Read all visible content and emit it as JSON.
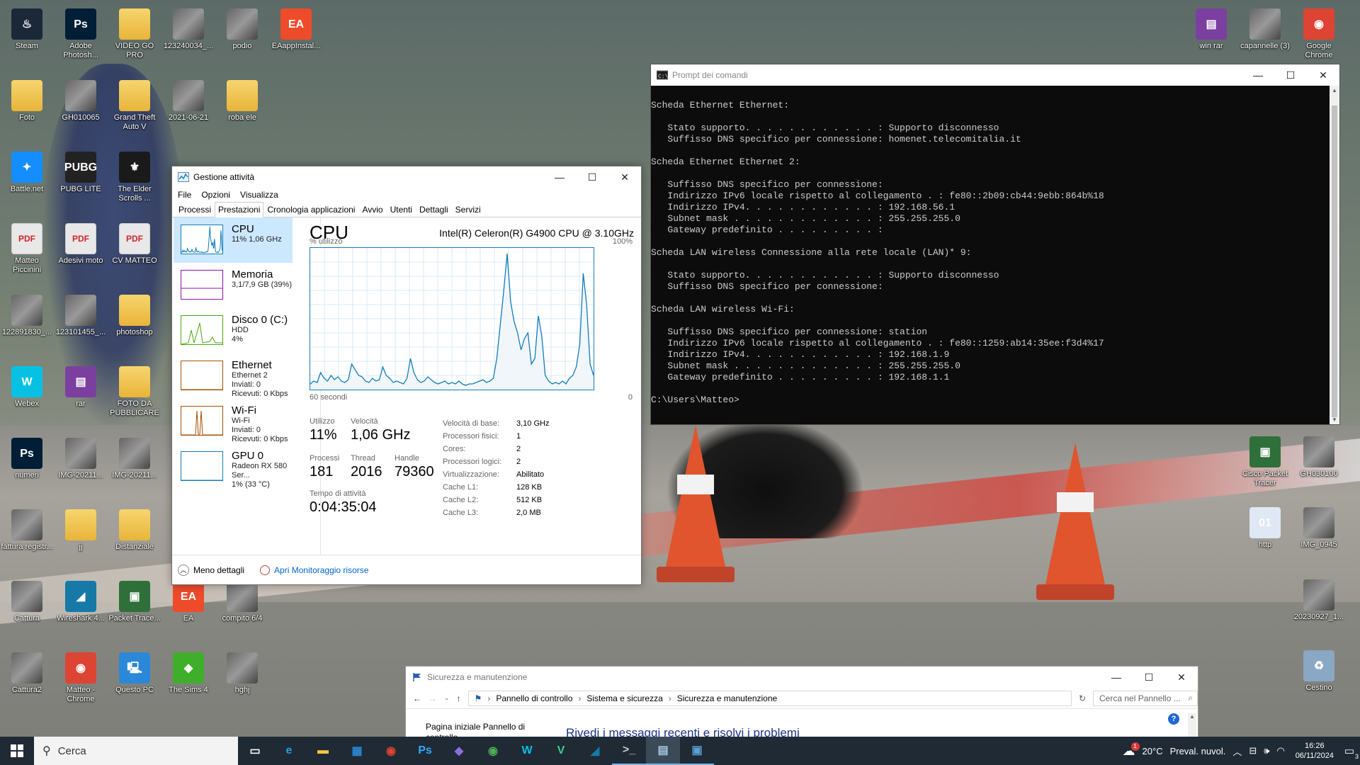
{
  "desktop": {
    "icons": [
      {
        "label": "Steam",
        "glyph": "♨",
        "kind": "app",
        "color": "#1b2838",
        "col": 0,
        "row": 0
      },
      {
        "label": "Adobe Photosh...",
        "glyph": "Ps",
        "kind": "app",
        "color": "#001e36",
        "col": 1,
        "row": 0
      },
      {
        "label": "VIDEO GO PRO",
        "glyph": "",
        "kind": "folder",
        "col": 2,
        "row": 0
      },
      {
        "label": "123240034_...",
        "glyph": "",
        "kind": "photo",
        "col": 3,
        "row": 0
      },
      {
        "label": "podio",
        "glyph": "",
        "kind": "photo",
        "col": 4,
        "row": 0
      },
      {
        "label": "EAappInstal...",
        "glyph": "EA",
        "kind": "app",
        "color": "#ee4b2b",
        "col": 5,
        "row": 0
      },
      {
        "label": "Foto",
        "glyph": "",
        "kind": "folder",
        "col": 0,
        "row": 1
      },
      {
        "label": "GH010065",
        "glyph": "",
        "kind": "photo",
        "col": 1,
        "row": 1
      },
      {
        "label": "Grand Theft Auto V",
        "glyph": "",
        "kind": "folder",
        "col": 2,
        "row": 1
      },
      {
        "label": "2021-06-21",
        "glyph": "",
        "kind": "photo",
        "col": 3,
        "row": 1
      },
      {
        "label": "roba ele",
        "glyph": "",
        "kind": "folder",
        "col": 4,
        "row": 1
      },
      {
        "label": "Battle.net",
        "glyph": "✦",
        "kind": "app",
        "color": "#148eff",
        "col": 0,
        "row": 2
      },
      {
        "label": "PUBG LITE",
        "glyph": "PUBG",
        "kind": "app",
        "color": "#222222",
        "col": 1,
        "row": 2
      },
      {
        "label": "The Elder Scrolls ...",
        "glyph": "⚜",
        "kind": "app",
        "color": "#1a1a1a",
        "col": 2,
        "row": 2
      },
      {
        "label": "Matteo Piccinini",
        "glyph": "PDF",
        "kind": "pdf",
        "col": 0,
        "row": 3
      },
      {
        "label": "Adesivi moto",
        "glyph": "PDF",
        "kind": "pdf",
        "col": 1,
        "row": 3
      },
      {
        "label": "CV MATTEO",
        "glyph": "PDF",
        "kind": "pdf",
        "col": 2,
        "row": 3
      },
      {
        "label": "122891830_...",
        "glyph": "",
        "kind": "photo",
        "col": 0,
        "row": 4
      },
      {
        "label": "123101455_...",
        "glyph": "",
        "kind": "photo",
        "col": 1,
        "row": 4
      },
      {
        "label": "photoshop",
        "glyph": "",
        "kind": "folder",
        "col": 2,
        "row": 4
      },
      {
        "label": "Webex",
        "glyph": "W",
        "kind": "app",
        "color": "#07c1e4",
        "col": 0,
        "row": 5
      },
      {
        "label": "rar",
        "glyph": "▤",
        "kind": "app",
        "color": "#7b3fa0",
        "col": 1,
        "row": 5
      },
      {
        "label": "FOTO DA PUBBLICARE",
        "glyph": "",
        "kind": "folder",
        "col": 2,
        "row": 5
      },
      {
        "label": "numeri",
        "glyph": "Ps",
        "kind": "app",
        "color": "#001e36",
        "col": 0,
        "row": 6
      },
      {
        "label": "IMG-20211...",
        "glyph": "",
        "kind": "photo",
        "col": 1,
        "row": 6
      },
      {
        "label": "IMG-20211...",
        "glyph": "",
        "kind": "photo",
        "col": 2,
        "row": 6
      },
      {
        "label": "fattura registr...",
        "glyph": "",
        "kind": "photo",
        "col": 0,
        "row": 7
      },
      {
        "label": "jj",
        "glyph": "",
        "kind": "folder",
        "col": 1,
        "row": 7
      },
      {
        "label": "Distanziale",
        "glyph": "",
        "kind": "folder",
        "col": 2,
        "row": 7
      },
      {
        "label": "Cattura",
        "glyph": "",
        "kind": "photo",
        "col": 0,
        "row": 8
      },
      {
        "label": "Wireshark 4...",
        "glyph": "◢",
        "kind": "app",
        "color": "#1679a7",
        "col": 1,
        "row": 8
      },
      {
        "label": "Packet Trace...",
        "glyph": "▣",
        "kind": "app",
        "color": "#2f6f3a",
        "col": 2,
        "row": 8
      },
      {
        "label": "EA",
        "glyph": "EA",
        "kind": "app",
        "color": "#ee4b2b",
        "col": 3,
        "row": 8
      },
      {
        "label": "compito 6/4",
        "glyph": "",
        "kind": "photo",
        "col": 4,
        "row": 8
      },
      {
        "label": "Cattura2",
        "glyph": "",
        "kind": "photo",
        "col": 0,
        "row": 9
      },
      {
        "label": "Matteo - Chrome",
        "glyph": "◉",
        "kind": "app",
        "color": "#dd4433",
        "col": 1,
        "row": 9
      },
      {
        "label": "Questo PC",
        "glyph": "🖳",
        "kind": "app",
        "color": "#2b88d8",
        "col": 2,
        "row": 9
      },
      {
        "label": "The Sims 4",
        "glyph": "◆",
        "kind": "app",
        "color": "#3fae2a",
        "col": 3,
        "row": 9
      },
      {
        "label": "hghj",
        "glyph": "",
        "kind": "photo",
        "col": 4,
        "row": 9
      }
    ],
    "right_icons": [
      {
        "label": "win rar",
        "glyph": "▤",
        "kind": "app",
        "color": "#7b3fa0"
      },
      {
        "label": "capannelle (3)",
        "glyph": "",
        "kind": "photo"
      },
      {
        "label": "Google Chrome",
        "glyph": "◉",
        "kind": "app",
        "color": "#dd4433"
      },
      {
        "label": "Cisco Packet Tracer",
        "glyph": "▣",
        "kind": "app",
        "color": "#2f6f3a"
      },
      {
        "label": "GH030100",
        "glyph": "",
        "kind": "photo"
      },
      {
        "label": "http",
        "glyph": "01",
        "kind": "app",
        "color": "#dfe8f5"
      },
      {
        "label": "IMG_0945",
        "glyph": "",
        "kind": "photo"
      },
      {
        "label": "20230927_1...",
        "glyph": "",
        "kind": "photo"
      },
      {
        "label": "Cestino",
        "glyph": "♻",
        "kind": "app",
        "color": "#8aa7c4"
      }
    ]
  },
  "task_manager": {
    "title": "Gestione attività",
    "menu": [
      "File",
      "Opzioni",
      "Visualizza"
    ],
    "tabs": [
      "Processi",
      "Prestazioni",
      "Cronologia applicazioni",
      "Avvio",
      "Utenti",
      "Dettagli",
      "Servizi"
    ],
    "active_tab": "Prestazioni",
    "resources": [
      {
        "name": "CPU",
        "sub1": "11% 1,06 GHz",
        "sub2": "",
        "sub3": "",
        "color": "#117dbb"
      },
      {
        "name": "Memoria",
        "sub1": "3,1/7,9 GB (39%)",
        "sub2": "",
        "sub3": "",
        "color": "#8b12ae"
      },
      {
        "name": "Disco 0 (C:)",
        "sub1": "HDD",
        "sub2": "4%",
        "sub3": "",
        "color": "#4da60c"
      },
      {
        "name": "Ethernet",
        "sub1": "Ethernet 2",
        "sub2": "Inviati: 0 Ricevuti: 0 Kbps",
        "sub3": "",
        "color": "#a74f01"
      },
      {
        "name": "Wi-Fi",
        "sub1": "Wi-Fi",
        "sub2": "Inviati: 0 Ricevuti: 0 Kbps",
        "sub3": "",
        "color": "#a74f01"
      },
      {
        "name": "GPU 0",
        "sub1": "Radeon RX 580 Ser...",
        "sub2": "1% (33 °C)",
        "sub3": "",
        "color": "#117dbb"
      }
    ],
    "cpu": {
      "heading": "CPU",
      "model": "Intel(R) Celeron(R) G4900 CPU @ 3.10GHz",
      "util_label": "% utilizzo",
      "max_label": "100%",
      "time_label": "60 secondi",
      "zero_label": "0",
      "stats": {
        "utilizzo_label": "Utilizzo",
        "utilizzo": "11%",
        "velocita_label": "Velocità",
        "velocita": "1,06 GHz",
        "processi_label": "Processi",
        "processi": "181",
        "thread_label": "Thread",
        "thread": "2016",
        "handle_label": "Handle",
        "handle": "79360",
        "uptime_label": "Tempo di attività",
        "uptime": "0:04:35:04"
      },
      "specs": [
        {
          "k": "Velocità di base:",
          "v": "3,10 GHz"
        },
        {
          "k": "Processori fisici:",
          "v": "1"
        },
        {
          "k": "Cores:",
          "v": "2"
        },
        {
          "k": "Processori logici:",
          "v": "2"
        },
        {
          "k": "Virtualizzazione:",
          "v": "Abilitato"
        },
        {
          "k": "Cache L1:",
          "v": "128 KB"
        },
        {
          "k": "Cache L2:",
          "v": "512 KB"
        },
        {
          "k": "Cache L3:",
          "v": "2,0 MB"
        }
      ],
      "history": [
        4,
        6,
        5,
        12,
        8,
        6,
        10,
        7,
        9,
        6,
        5,
        7,
        18,
        14,
        10,
        9,
        6,
        5,
        8,
        6,
        7,
        16,
        10,
        8,
        5,
        6,
        5,
        4,
        8,
        22,
        12,
        7,
        5,
        6,
        9,
        7,
        5,
        4,
        5,
        6,
        4,
        5,
        4,
        6,
        4,
        3,
        4,
        4,
        5,
        6,
        7,
        5,
        6,
        8,
        22,
        46,
        70,
        96,
        62,
        48,
        40,
        28,
        36,
        40,
        18,
        22,
        52,
        38,
        10,
        6,
        4,
        5,
        4,
        6,
        4,
        8,
        10,
        16,
        32,
        82,
        60,
        18,
        10
      ]
    },
    "footer_less": "Meno dettagli",
    "footer_link": "Apri Monitoraggio risorse"
  },
  "cmd": {
    "title": "Prompt dei comandi",
    "lines": [
      "",
      "Scheda Ethernet Ethernet:",
      "",
      "   Stato supporto. . . . . . . . . . . . : Supporto disconnesso",
      "   Suffisso DNS specifico per connessione: homenet.telecomitalia.it",
      "",
      "Scheda Ethernet Ethernet 2:",
      "",
      "   Suffisso DNS specifico per connessione:",
      "   Indirizzo IPv6 locale rispetto al collegamento . : fe80::2b09:cb44:9ebb:864b%18",
      "   Indirizzo IPv4. . . . . . . . . . . . : 192.168.56.1",
      "   Subnet mask . . . . . . . . . . . . . : 255.255.255.0",
      "   Gateway predefinito . . . . . . . . . :",
      "",
      "Scheda LAN wireless Connessione alla rete locale (LAN)* 9:",
      "",
      "   Stato supporto. . . . . . . . . . . . : Supporto disconnesso",
      "   Suffisso DNS specifico per connessione:",
      "",
      "Scheda LAN wireless Wi-Fi:",
      "",
      "   Suffisso DNS specifico per connessione: station",
      "   Indirizzo IPv6 locale rispetto al collegamento . : fe80::1259:ab14:35ee:f3d4%17",
      "   Indirizzo IPv4. . . . . . . . . . . . : 192.168.1.9",
      "   Subnet mask . . . . . . . . . . . . . : 255.255.255.0",
      "   Gateway predefinito . . . . . . . . . : 192.168.1.1",
      "",
      "C:\\Users\\Matteo>"
    ]
  },
  "security": {
    "title": "Sicurezza e manutenzione",
    "breadcrumb": [
      "Pannello di controllo",
      "Sistema e sicurezza",
      "Sicurezza e manutenzione"
    ],
    "search_placeholder": "Cerca nel Pannello ...",
    "sidebar_link": "Pagina iniziale Pannello di controllo",
    "heading": "Rivedi i messaggi recenti e risolvi i problemi"
  },
  "taskbar": {
    "search_label": "Cerca",
    "apps": [
      {
        "name": "task-view",
        "glyph": "▭",
        "color": "#ffffff",
        "state": ""
      },
      {
        "name": "edge",
        "glyph": "e",
        "color": "#1f9de8",
        "state": ""
      },
      {
        "name": "file-explorer",
        "glyph": "▬",
        "color": "#f4c542",
        "state": ""
      },
      {
        "name": "store",
        "glyph": "▦",
        "color": "#2b88d8",
        "state": ""
      },
      {
        "name": "chrome",
        "glyph": "◉",
        "color": "#dd4433",
        "state": ""
      },
      {
        "name": "photoshop",
        "glyph": "Ps",
        "color": "#31a8ff",
        "state": ""
      },
      {
        "name": "copilot",
        "glyph": "◆",
        "color": "#8b6fe0",
        "state": ""
      },
      {
        "name": "chrome-profile",
        "glyph": "◉",
        "color": "#4caf50",
        "state": ""
      },
      {
        "name": "webex",
        "glyph": "W",
        "color": "#07c1e4",
        "state": ""
      },
      {
        "name": "vpn",
        "glyph": "V",
        "color": "#3ccf8e",
        "state": ""
      },
      {
        "name": "wireshark",
        "glyph": "◢",
        "color": "#1679a7",
        "state": ""
      },
      {
        "name": "cmd",
        "glyph": ">_",
        "color": "#cccccc",
        "state": "open"
      },
      {
        "name": "task-manager",
        "glyph": "▤",
        "color": "#a6c8e0",
        "state": "active"
      },
      {
        "name": "control-panel",
        "glyph": "▣",
        "color": "#5aa0d8",
        "state": "open"
      }
    ],
    "weather_temp": "20°C",
    "weather_text": "Preval. nuvol.",
    "weather_badge": "1",
    "time": "16:26",
    "date": "06/11/2024",
    "notif_count": "3"
  },
  "colors": {
    "accent": "#117dbb",
    "link": "#0066cc",
    "taskbar_bg": "#1f2a35"
  }
}
